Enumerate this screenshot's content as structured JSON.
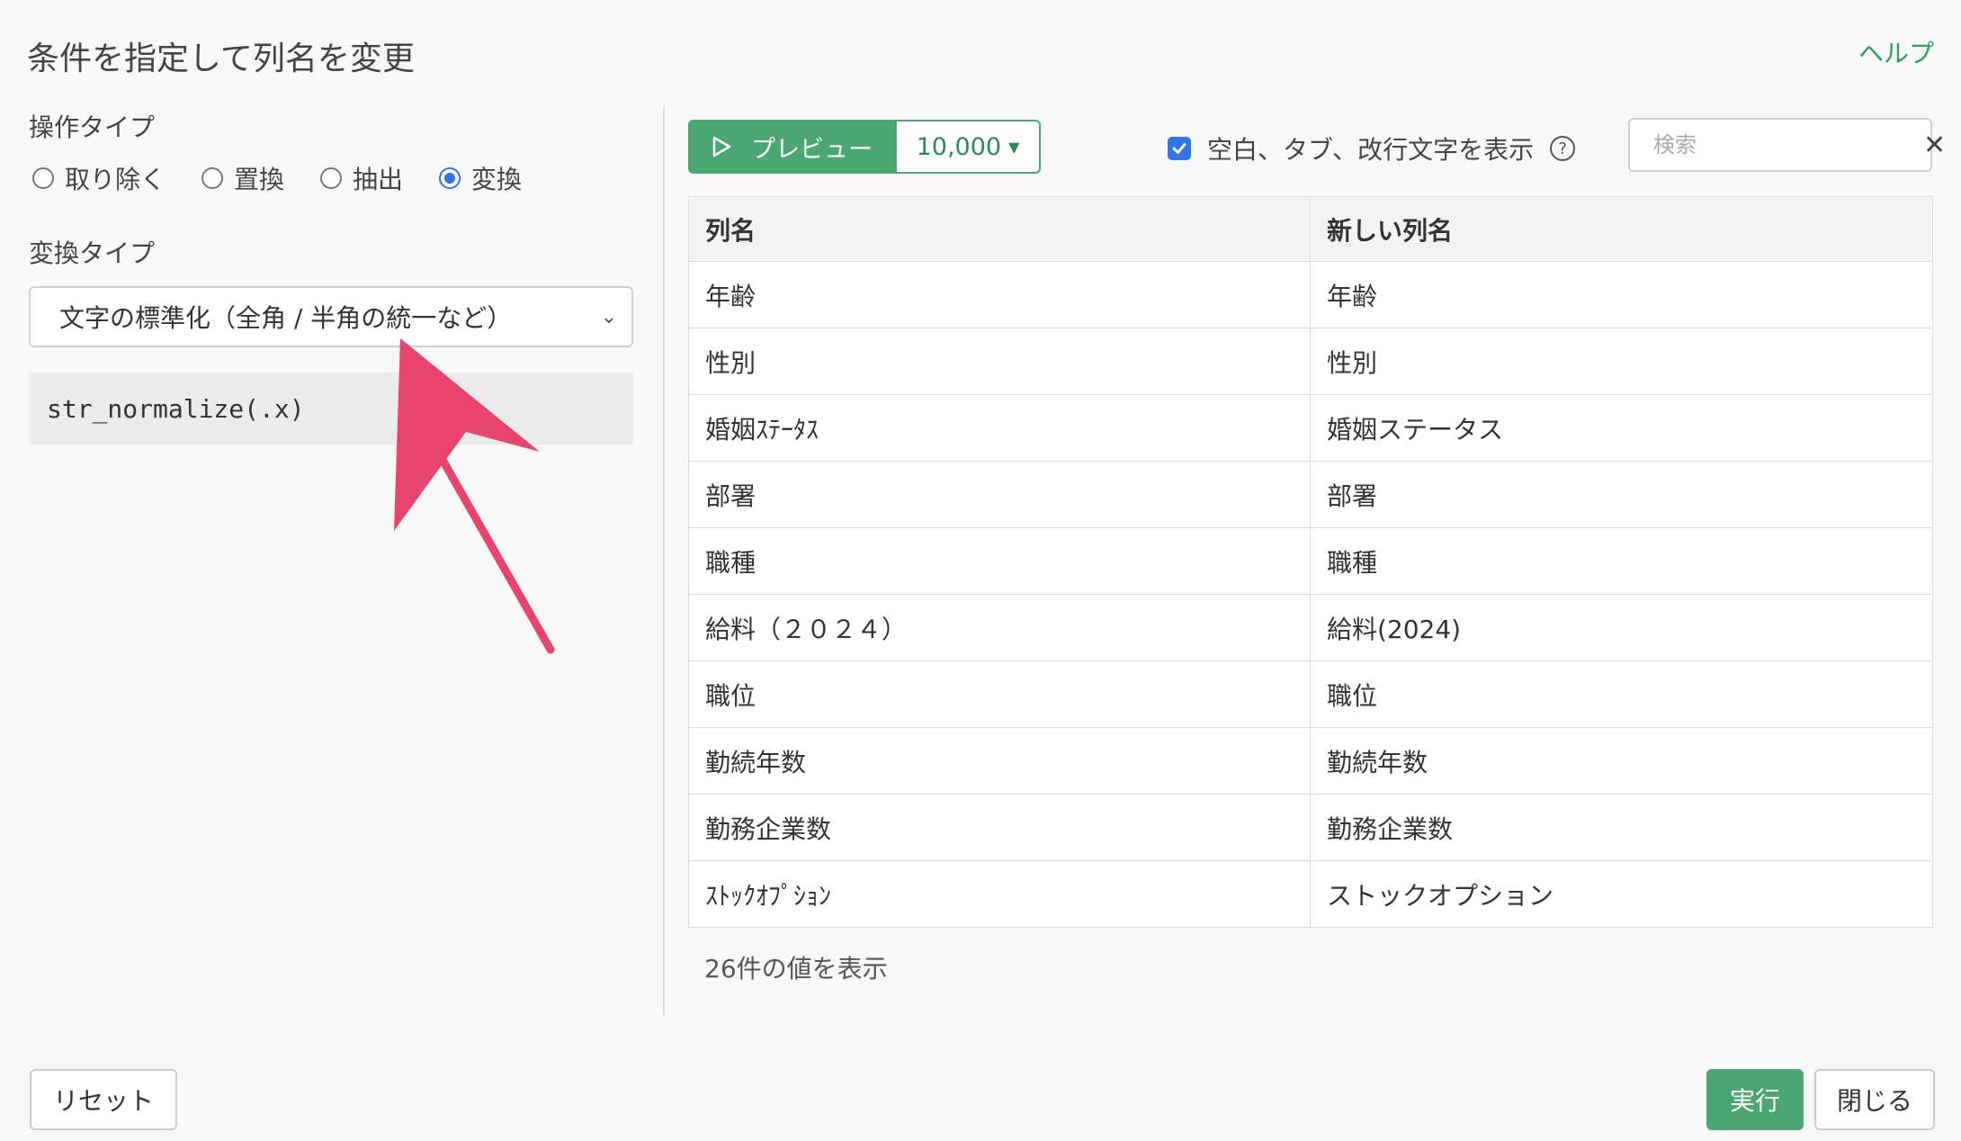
{
  "dialog": {
    "title": "条件を指定して列名を変更",
    "help_link": "ヘルプ"
  },
  "left": {
    "operation_type_label": "操作タイプ",
    "operation_types": [
      {
        "label": "取り除く",
        "selected": false
      },
      {
        "label": "置換",
        "selected": false
      },
      {
        "label": "抽出",
        "selected": false
      },
      {
        "label": "変換",
        "selected": true
      }
    ],
    "transform_type_label": "変換タイプ",
    "transform_type_value": "文字の標準化（全角 / 半角の統一など）",
    "code": "str_normalize(.x)"
  },
  "preview": {
    "button_label": "プレビュー",
    "row_count": "10,000",
    "show_whitespace_label": "空白、タブ、改行文字を表示",
    "show_whitespace_checked": true,
    "search_placeholder": "検索"
  },
  "table": {
    "headers": [
      "列名",
      "新しい列名"
    ],
    "rows": [
      [
        "年齢",
        "年齢"
      ],
      [
        "性別",
        "性別"
      ],
      [
        "婚姻ｽﾃｰﾀｽ",
        "婚姻ステータス"
      ],
      [
        "部署",
        "部署"
      ],
      [
        "職種",
        "職種"
      ],
      [
        "給料（２０２４）",
        "給料(2024)"
      ],
      [
        "職位",
        "職位"
      ],
      [
        "勤続年数",
        "勤続年数"
      ],
      [
        "勤務企業数",
        "勤務企業数"
      ],
      [
        "ｽﾄｯｸｵﾌﾟｼｮﾝ",
        "ストックオプション"
      ]
    ],
    "count_note": "26件の値を表示"
  },
  "footer": {
    "reset_label": "リセット",
    "run_label": "実行",
    "close_label": "閉じる"
  },
  "colors": {
    "accent_green": "#4ba671",
    "radio_blue": "#2f74e8",
    "annotation_pink": "#e8456e"
  }
}
